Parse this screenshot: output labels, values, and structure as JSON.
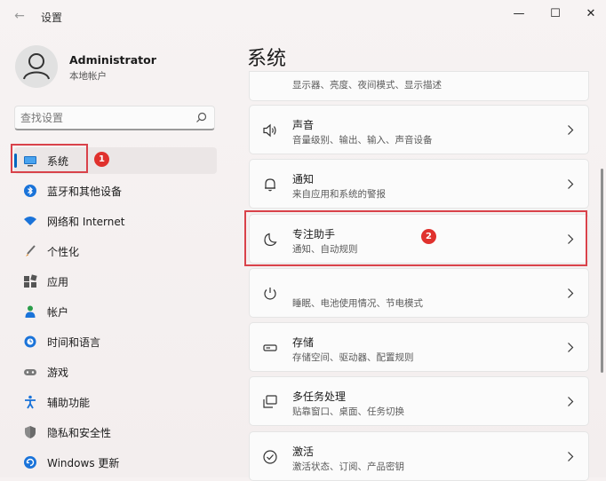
{
  "window": {
    "title": "设置",
    "back_glyph": "←",
    "minimize_glyph": "—",
    "maximize_glyph": "☐",
    "close_glyph": "✕"
  },
  "user": {
    "name": "Administrator",
    "type": "本地帐户"
  },
  "search": {
    "placeholder": "查找设置"
  },
  "nav": {
    "items": [
      {
        "label": "系统",
        "icon": "monitor-icon",
        "active": true
      },
      {
        "label": "蓝牙和其他设备",
        "icon": "bluetooth-icon"
      },
      {
        "label": "网络和 Internet",
        "icon": "wifi-icon"
      },
      {
        "label": "个性化",
        "icon": "brush-icon"
      },
      {
        "label": "应用",
        "icon": "apps-icon"
      },
      {
        "label": "帐户",
        "icon": "person-icon"
      },
      {
        "label": "时间和语言",
        "icon": "globe-clock-icon"
      },
      {
        "label": "游戏",
        "icon": "gamepad-icon"
      },
      {
        "label": "辅助功能",
        "icon": "accessibility-icon"
      },
      {
        "label": "隐私和安全性",
        "icon": "shield-icon"
      },
      {
        "label": "Windows 更新",
        "icon": "update-icon"
      }
    ]
  },
  "annotations": {
    "badge_1": "1",
    "badge_2": "2"
  },
  "main": {
    "title": "系统",
    "partial_card_subtitle": "显示器、亮度、夜间模式、显示描述",
    "cards": [
      {
        "title": "声音",
        "subtitle": "音量级别、输出、输入、声音设备",
        "icon": "speaker-icon"
      },
      {
        "title": "通知",
        "subtitle": "来自应用和系统的警报",
        "icon": "bell-icon"
      },
      {
        "title": "专注助手",
        "subtitle": "通知、自动规则",
        "icon": "moon-icon"
      },
      {
        "title": "",
        "subtitle": "睡眠、电池使用情况、节电模式",
        "icon": "power-icon"
      },
      {
        "title": "存储",
        "subtitle": "存储空间、驱动器、配置规则",
        "icon": "storage-icon"
      },
      {
        "title": "多任务处理",
        "subtitle": "贴靠窗口、桌面、任务切换",
        "icon": "multitask-icon"
      },
      {
        "title": "激活",
        "subtitle": "激活状态、订阅、产品密钥",
        "icon": "check-circle-icon"
      }
    ]
  },
  "colors": {
    "accent": "#0067c0",
    "annotation_red": "#d9424a"
  }
}
